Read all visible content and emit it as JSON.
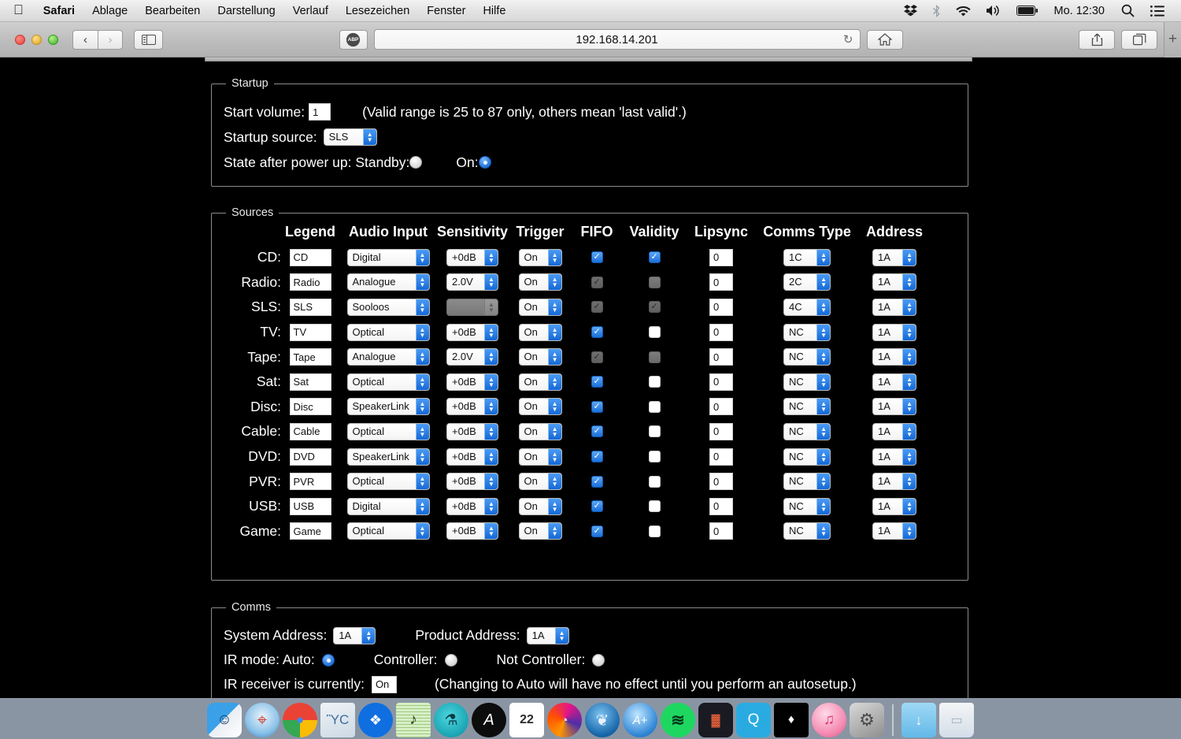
{
  "menubar": {
    "apple_icon": "apple-logo-icon",
    "items": [
      "Safari",
      "Ablage",
      "Bearbeiten",
      "Darstellung",
      "Verlauf",
      "Lesezeichen",
      "Fenster",
      "Hilfe"
    ],
    "status_icons": [
      "dropbox-icon",
      "bluetooth-icon",
      "wifi-icon",
      "volume-icon",
      "battery-icon"
    ],
    "clock": "Mo. 12:30",
    "search_icon": "search-icon",
    "notification_icon": "notification-center-icon"
  },
  "toolbar": {
    "back_icon": "chevron-left-icon",
    "forward_icon": "chevron-right-icon",
    "sidebar_icon": "sidebar-icon",
    "adblock_label": "ABP",
    "url": "192.168.14.201",
    "reload_icon": "reload-icon",
    "home_icon": "home-icon",
    "share_icon": "share-icon",
    "tabs_icon": "show-all-tabs-icon",
    "new_tab_label": "+"
  },
  "startup": {
    "legend": "Startup",
    "start_volume_label": "Start volume:",
    "start_volume_value": "1",
    "start_volume_hint": "(Valid range is 25 to 87 only, others mean 'last valid'.)",
    "startup_source_label": "Startup source:",
    "startup_source_value": "SLS",
    "state_label": "State after power up: Standby:",
    "standby_selected": false,
    "on_label": "On:",
    "on_selected": true
  },
  "sources": {
    "legend": "Sources",
    "columns": [
      "Legend",
      "Audio Input",
      "Sensitivity",
      "Trigger",
      "FIFO",
      "Validity",
      "Lipsync",
      "Comms Type",
      "Address"
    ],
    "rows": [
      {
        "name": "CD:",
        "legend": "CD",
        "audio": "Digital",
        "audio_disabled": false,
        "sens": "+0dB",
        "sens_disabled": false,
        "trigger": "On",
        "fifo": "on",
        "validity": "on",
        "lipsync": "0",
        "comms": "1C",
        "address": "1A"
      },
      {
        "name": "Radio:",
        "legend": "Radio",
        "audio": "Analogue",
        "audio_disabled": false,
        "sens": "2.0V",
        "sens_disabled": false,
        "trigger": "On",
        "fifo": "dis-on",
        "validity": "dis-off",
        "lipsync": "0",
        "comms": "2C",
        "address": "1A"
      },
      {
        "name": "SLS:",
        "legend": "SLS",
        "audio": "Sooloos",
        "audio_disabled": false,
        "sens": "",
        "sens_disabled": true,
        "trigger": "On",
        "fifo": "dis-on",
        "validity": "dis-on",
        "lipsync": "0",
        "comms": "4C",
        "address": "1A"
      },
      {
        "name": "TV:",
        "legend": "TV",
        "audio": "Optical",
        "audio_disabled": false,
        "sens": "+0dB",
        "sens_disabled": false,
        "trigger": "On",
        "fifo": "on",
        "validity": "off",
        "lipsync": "0",
        "comms": "NC",
        "address": "1A"
      },
      {
        "name": "Tape:",
        "legend": "Tape",
        "audio": "Analogue",
        "audio_disabled": false,
        "sens": "2.0V",
        "sens_disabled": false,
        "trigger": "On",
        "fifo": "dis-on",
        "validity": "dis-off",
        "lipsync": "0",
        "comms": "NC",
        "address": "1A"
      },
      {
        "name": "Sat:",
        "legend": "Sat",
        "audio": "Optical",
        "audio_disabled": false,
        "sens": "+0dB",
        "sens_disabled": false,
        "trigger": "On",
        "fifo": "on",
        "validity": "off",
        "lipsync": "0",
        "comms": "NC",
        "address": "1A"
      },
      {
        "name": "Disc:",
        "legend": "Disc",
        "audio": "SpeakerLink",
        "audio_disabled": false,
        "sens": "+0dB",
        "sens_disabled": false,
        "trigger": "On",
        "fifo": "on",
        "validity": "off",
        "lipsync": "0",
        "comms": "NC",
        "address": "1A"
      },
      {
        "name": "Cable:",
        "legend": "Cable",
        "audio": "Optical",
        "audio_disabled": false,
        "sens": "+0dB",
        "sens_disabled": false,
        "trigger": "On",
        "fifo": "on",
        "validity": "off",
        "lipsync": "0",
        "comms": "NC",
        "address": "1A"
      },
      {
        "name": "DVD:",
        "legend": "DVD",
        "audio": "SpeakerLink",
        "audio_disabled": false,
        "sens": "+0dB",
        "sens_disabled": false,
        "trigger": "On",
        "fifo": "on",
        "validity": "off",
        "lipsync": "0",
        "comms": "NC",
        "address": "1A"
      },
      {
        "name": "PVR:",
        "legend": "PVR",
        "audio": "Optical",
        "audio_disabled": false,
        "sens": "+0dB",
        "sens_disabled": false,
        "trigger": "On",
        "fifo": "on",
        "validity": "off",
        "lipsync": "0",
        "comms": "NC",
        "address": "1A"
      },
      {
        "name": "USB:",
        "legend": "USB",
        "audio": "Digital",
        "audio_disabled": false,
        "sens": "+0dB",
        "sens_disabled": false,
        "trigger": "On",
        "fifo": "on",
        "validity": "off",
        "lipsync": "0",
        "comms": "NC",
        "address": "1A"
      },
      {
        "name": "Game:",
        "legend": "Game",
        "audio": "Optical",
        "audio_disabled": false,
        "sens": "+0dB",
        "sens_disabled": false,
        "trigger": "On",
        "fifo": "on",
        "validity": "off",
        "lipsync": "0",
        "comms": "NC",
        "address": "1A"
      }
    ]
  },
  "comms": {
    "legend": "Comms",
    "system_address_label": "System Address:",
    "system_address_value": "1A",
    "product_address_label": "Product Address:",
    "product_address_value": "1A",
    "ir_mode_label": "IR mode: Auto:",
    "ir_auto_selected": true,
    "controller_label": "Controller:",
    "controller_selected": false,
    "not_controller_label": "Not Controller:",
    "not_controller_selected": false,
    "ir_receiver_label": "IR receiver is currently:",
    "ir_receiver_value": "On",
    "ir_hint": "(Changing to Auto will have no effect until you perform an autosetup.)"
  },
  "dock": {
    "items": [
      {
        "name": "finder",
        "glyph": "☺"
      },
      {
        "name": "safari",
        "glyph": "⌖"
      },
      {
        "name": "google-chrome",
        "glyph": "●"
      },
      {
        "name": "preview",
        "glyph": "ὛC"
      },
      {
        "name": "dropbox",
        "glyph": "❖"
      },
      {
        "name": "sheet-music",
        "glyph": "♪"
      },
      {
        "name": "microscope-app",
        "glyph": "⚗"
      },
      {
        "name": "affinity-photo",
        "glyph": "A"
      },
      {
        "name": "calendar",
        "glyph": "22"
      },
      {
        "name": "firefox",
        "glyph": "◔"
      },
      {
        "name": "seamonkey",
        "glyph": "❦"
      },
      {
        "name": "audio-app",
        "glyph": "A+"
      },
      {
        "name": "spotify",
        "glyph": "≋"
      },
      {
        "name": "equalizer-app",
        "glyph": "▓"
      },
      {
        "name": "quicktime",
        "glyph": "Q"
      },
      {
        "name": "tidal",
        "glyph": "♦"
      },
      {
        "name": "itunes",
        "glyph": "♫"
      },
      {
        "name": "system-preferences",
        "glyph": "⚙"
      },
      {
        "name": "downloads-folder",
        "glyph": "↓"
      },
      {
        "name": "trash",
        "glyph": "▭"
      }
    ]
  }
}
